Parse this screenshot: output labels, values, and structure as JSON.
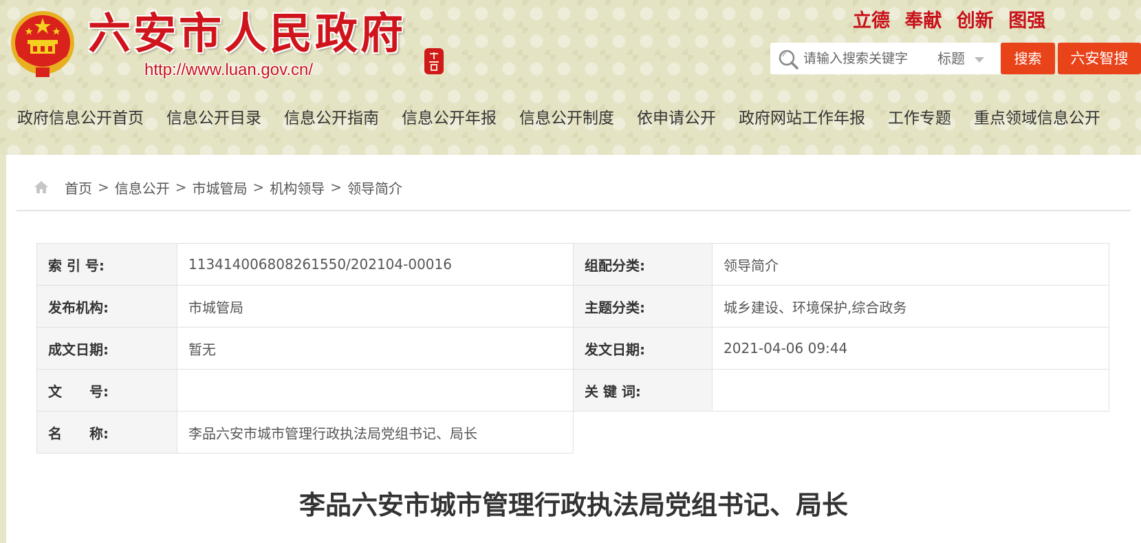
{
  "header": {
    "site_title": "六安市人民政府",
    "site_url": "http://www.luan.gov.cn/",
    "motto": "立德 奉献 创新 图强",
    "search_placeholder": "请输入搜索关键字",
    "search_scope": "标题",
    "search_button": "搜索",
    "smart_button": "六安智搜",
    "emblem_icon": "national-emblem-icon",
    "seal_icon": "red-seal-icon"
  },
  "nav": {
    "items": [
      {
        "label": "政府信息公开首页"
      },
      {
        "label": "信息公开目录"
      },
      {
        "label": "信息公开指南"
      },
      {
        "label": "信息公开年报"
      },
      {
        "label": "信息公开制度"
      },
      {
        "label": "依申请公开"
      },
      {
        "label": "政府网站工作年报"
      },
      {
        "label": "工作专题"
      },
      {
        "label": "重点领域信息公开"
      }
    ]
  },
  "breadcrumb": {
    "icon": "home-icon",
    "items": [
      "首页",
      "信息公开",
      "市城管局",
      "机构领导",
      "领导简介"
    ],
    "separator": ">"
  },
  "meta": {
    "index_label": "索 引 号:",
    "index_value": "113414006808261550/202104-00016",
    "category_label": "组配分类:",
    "category_value": "领导简介",
    "publisher_label": "发布机构:",
    "publisher_value": "市城管局",
    "topic_label": "主题分类:",
    "topic_value": "城乡建设、环境保护,综合政务",
    "created_label": "成文日期:",
    "created_value": "暂无",
    "published_label": "发文日期:",
    "published_value": "2021-04-06 09:44",
    "docno_label": "文　　号:",
    "docno_value": "",
    "keywords_label": "关 键 词:",
    "keywords_value": "",
    "name_label": "名　　称:",
    "name_value": "李品六安市城市管理行政执法局党组书记、局长"
  },
  "article": {
    "title": "李品六安市城市管理行政执法局党组书记、局长"
  },
  "colors": {
    "brand_red": "#d0141b",
    "button_orange": "#e9431a",
    "header_bg": "#e4e3c4"
  }
}
